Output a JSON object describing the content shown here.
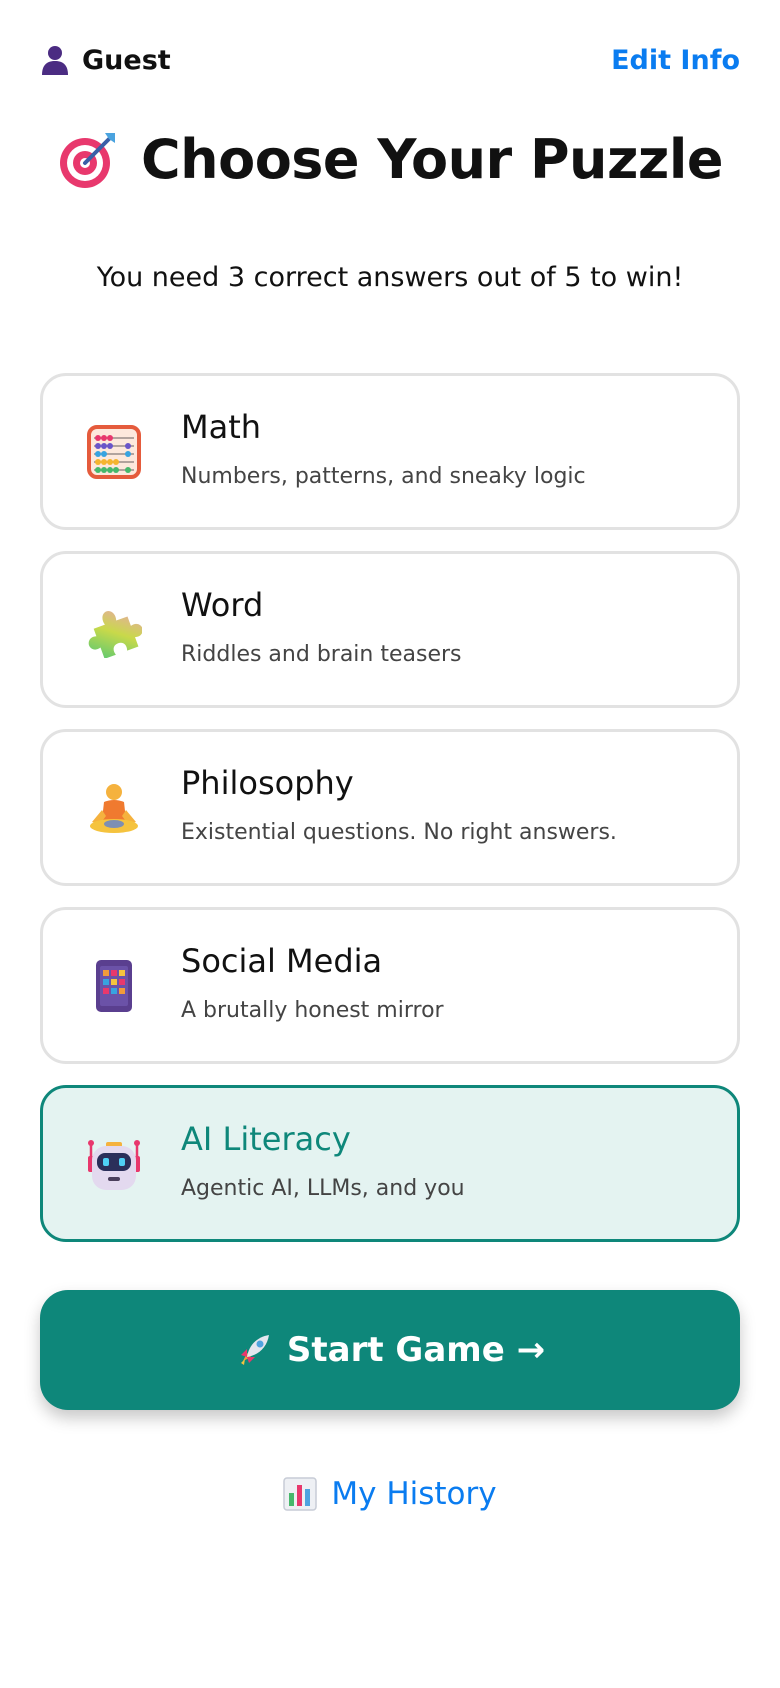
{
  "header": {
    "user_name": "Guest",
    "user_icon": "user-silhouette-icon",
    "edit_label": "Edit Info"
  },
  "hero": {
    "title": "Choose Your Puzzle",
    "title_icon": "target-dart-icon",
    "subtitle": "You need 3 correct answers out of 5 to win!"
  },
  "categories": [
    {
      "title": "Math",
      "description": "Numbers, patterns, and sneaky logic",
      "icon": "abacus-icon",
      "selected": false
    },
    {
      "title": "Word",
      "description": "Riddles and brain teasers",
      "icon": "puzzle-piece-icon",
      "selected": false
    },
    {
      "title": "Philosophy",
      "description": "Existential questions. No right answers.",
      "icon": "meditating-person-icon",
      "selected": false
    },
    {
      "title": "Social Media",
      "description": "A brutally honest mirror",
      "icon": "phone-apps-icon",
      "selected": false
    },
    {
      "title": "AI Literacy",
      "description": "Agentic AI, LLMs, and you",
      "icon": "robot-icon",
      "selected": true
    }
  ],
  "actions": {
    "start_label": "Start Game →",
    "start_icon": "rocket-icon",
    "history_label": "My History",
    "history_icon": "bar-chart-icon"
  },
  "colors": {
    "accent": "#0e877a",
    "link": "#0a7cf0",
    "selected_bg": "#e4f3f1"
  }
}
